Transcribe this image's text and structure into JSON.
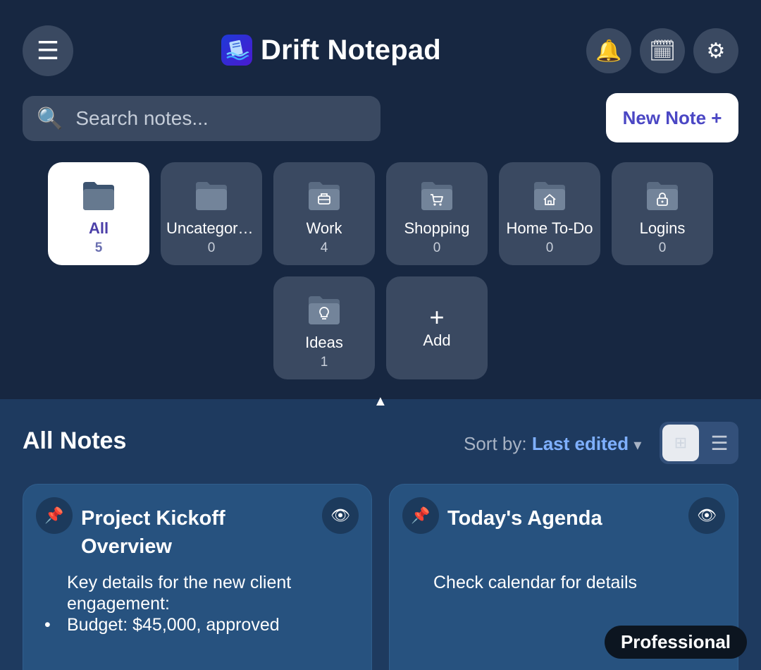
{
  "app": {
    "title": "Drift Notepad"
  },
  "header": {
    "menu_icon": "menu-icon",
    "bell_icon": "bell-icon",
    "calendar_icon": "calendar-icon",
    "settings_icon": "gear-icon"
  },
  "search": {
    "placeholder": "Search notes...",
    "value": ""
  },
  "actions": {
    "new_note_label": "New Note +"
  },
  "folders": [
    {
      "name": "All",
      "count": "5",
      "icon": "folder-icon",
      "active": true
    },
    {
      "name": "Uncategorized",
      "count": "0",
      "icon": "folder-icon",
      "active": false
    },
    {
      "name": "Work",
      "count": "4",
      "icon": "briefcase-folder-icon",
      "active": false
    },
    {
      "name": "Shopping",
      "count": "0",
      "icon": "cart-folder-icon",
      "active": false
    },
    {
      "name": "Home To-Do",
      "count": "0",
      "icon": "home-folder-icon",
      "active": false
    },
    {
      "name": "Logins",
      "count": "0",
      "icon": "lock-folder-icon",
      "active": false
    },
    {
      "name": "Ideas",
      "count": "1",
      "icon": "lightbulb-folder-icon",
      "active": false
    }
  ],
  "add_folder": {
    "plus": "+",
    "label": "Add"
  },
  "notes_section": {
    "title": "All Notes",
    "sort_label": "Sort by:",
    "sort_value": "Last edited",
    "sort_caret": "▾",
    "view_mode": "grid"
  },
  "notes": [
    {
      "title": "Project Kickoff Overview",
      "body": [
        "Key details for the new client engagement:"
      ],
      "bullets": [
        "Budget: $45,000, approved"
      ]
    },
    {
      "title": "Today's Agenda",
      "body": [
        "Check calendar for details"
      ],
      "bullets": []
    }
  ],
  "badge": {
    "label": "Professional"
  },
  "colors": {
    "header_bg": "#172741",
    "content_bg": "#1e3a5f",
    "tile_bg": "#3a4961",
    "card_bg": "#27527f",
    "accent": "#4b47c4",
    "sort_accent": "#7fb0ff"
  }
}
